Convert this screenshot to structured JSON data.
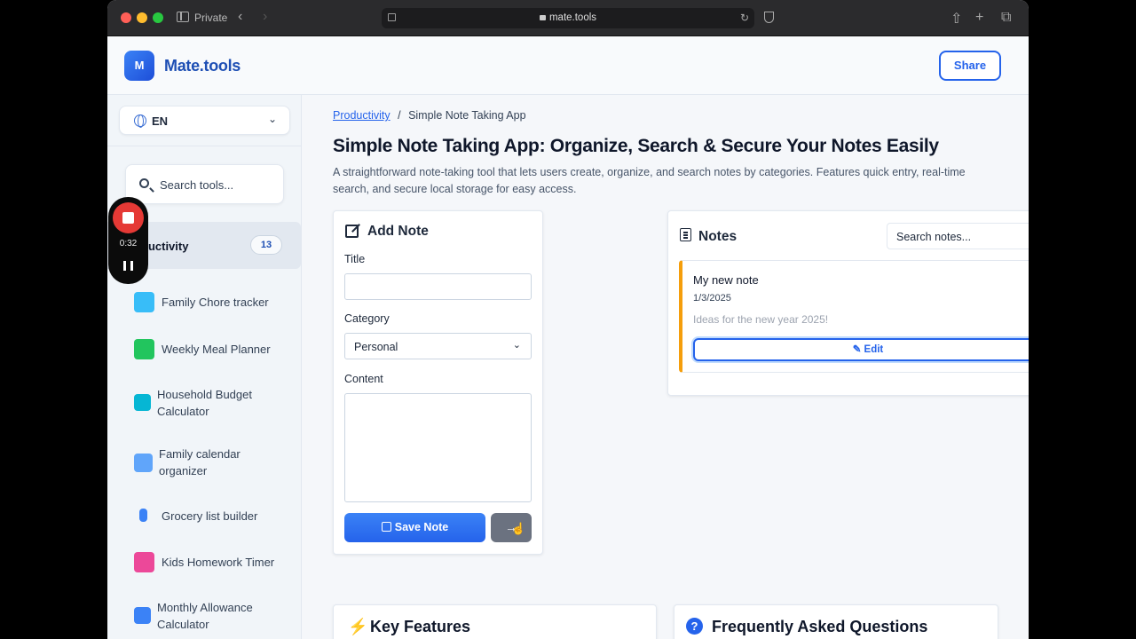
{
  "browser": {
    "private_label": "Private",
    "url": "mate.tools"
  },
  "header": {
    "logo_letter": "M",
    "logo_text": "Mate.tools",
    "share_label": "Share"
  },
  "sidebar": {
    "language": "EN",
    "search_placeholder": "Search tools...",
    "category": {
      "label": "ductivity",
      "count": "13"
    },
    "tools": [
      {
        "name": "Family Chore tracker",
        "icon": "checklist-icon",
        "color": "#38bdf8"
      },
      {
        "name": "Weekly Meal Planner",
        "icon": "calendar-icon",
        "color": "#22c55e"
      },
      {
        "name": "Household Budget Calculator",
        "icon": "calculator-icon",
        "color": "#06b6d4"
      },
      {
        "name": "Family calendar organizer",
        "icon": "calendar-icon",
        "color": "#60a5fa"
      },
      {
        "name": "Grocery list builder",
        "icon": "cart-icon",
        "color": "#3b82f6"
      },
      {
        "name": "Kids Homework Timer",
        "icon": "timer-icon",
        "color": "#ec4899"
      },
      {
        "name": "Monthly Allowance Calculator",
        "icon": "calculator-icon",
        "color": "#3b82f6"
      }
    ]
  },
  "recorder": {
    "time": "0:32"
  },
  "breadcrumb": {
    "parent": "Productivity",
    "separator": "/",
    "current": "Simple Note Taking App"
  },
  "page": {
    "title": "Simple Note Taking App: Organize, Search & Secure Your Notes Easily",
    "description": "A straightforward note-taking tool that lets users create, organize, and search notes by categories. Features quick entry, real-time search, and secure local storage for easy access."
  },
  "add_note": {
    "title": "Add Note",
    "title_label": "Title",
    "title_value": "",
    "category_label": "Category",
    "category_value": "Personal",
    "content_label": "Content",
    "content_value": "",
    "save_label": "Save Note",
    "clear_label": "→"
  },
  "notes": {
    "title": "Notes",
    "search_placeholder": "Search notes...",
    "items": [
      {
        "title": "My new note",
        "date": "1/3/2025",
        "body": "Ideas for the new year 2025!",
        "edit_label": "Edit",
        "category_color": "#f59e0b"
      }
    ]
  },
  "sections": {
    "features_title": "Key Features",
    "faq_title": "Frequently Asked Questions"
  }
}
